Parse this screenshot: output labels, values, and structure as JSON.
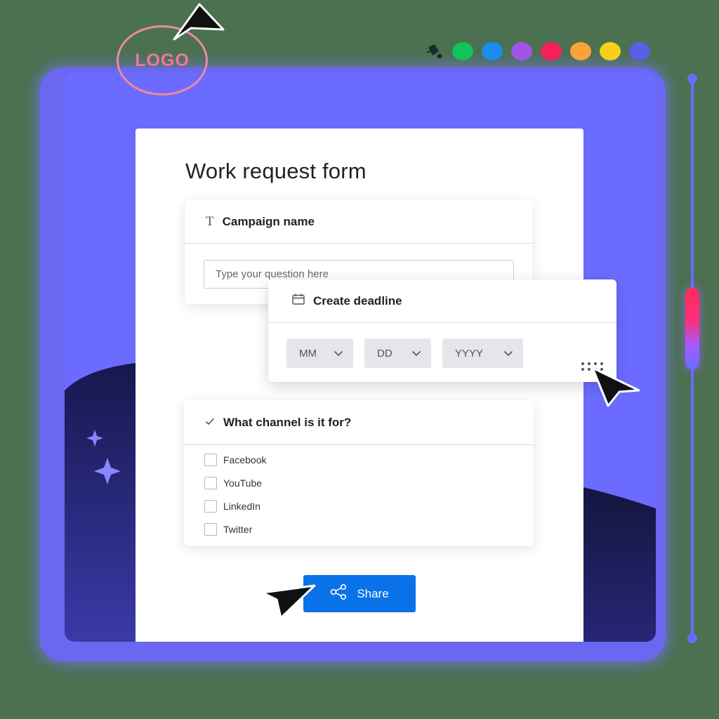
{
  "logo": {
    "text": "LOGO"
  },
  "swatches": {
    "bucket_icon": "paint-bucket-icon",
    "colors": [
      "#12c25a",
      "#1a8cf0",
      "#a154e8",
      "#f5215a",
      "#f9a23a",
      "#f8cf1a",
      "#5a5fe6"
    ]
  },
  "form": {
    "title": "Work request form",
    "campaign": {
      "icon": "text-icon",
      "label": "Campaign name",
      "placeholder": "Type your question here"
    },
    "deadline": {
      "icon": "calendar-icon",
      "label": "Create deadline",
      "month": "MM",
      "day": "DD",
      "year": "YYYY"
    },
    "channel": {
      "icon": "check-icon",
      "label": "What channel is it for?",
      "options": [
        "Facebook",
        "YouTube",
        "LinkedIn",
        "Twitter"
      ]
    },
    "share_button": {
      "icon": "share-icon",
      "label": "Share"
    }
  },
  "colors": {
    "background": "#4b7150",
    "frame": "#6b6bff",
    "dark_wave": "#1d1c5c",
    "accent": "#0a72e8"
  }
}
